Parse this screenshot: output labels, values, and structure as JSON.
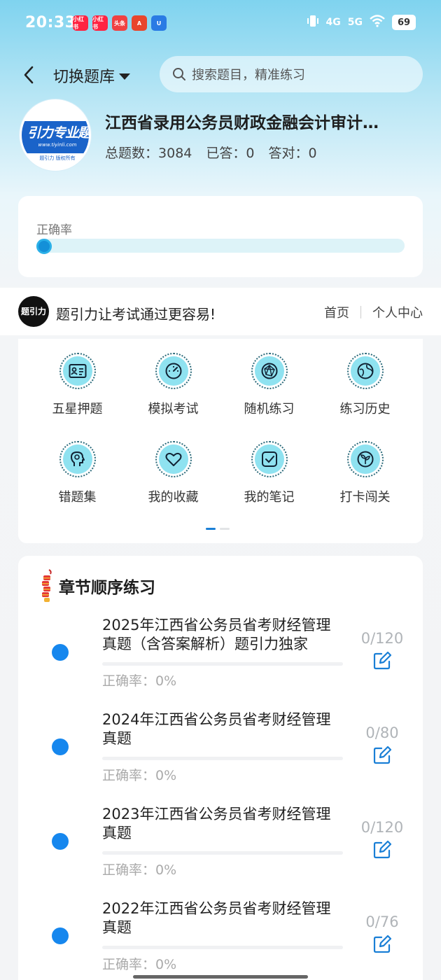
{
  "status_bar": {
    "time": "20:33",
    "battery": "69",
    "network_labels": [
      "4G",
      "5G"
    ],
    "apps": [
      {
        "label": "小红书",
        "color": "#ff2442"
      },
      {
        "label": "小红书",
        "color": "#ff2442"
      },
      {
        "label": "头条",
        "color": "#f04142"
      },
      {
        "label": "A",
        "color": "#e8452c"
      },
      {
        "label": "U",
        "color": "#2a7be4"
      }
    ]
  },
  "topbar": {
    "switch_label": "切换题库",
    "search_placeholder": "搜索题目，精准练习"
  },
  "bank": {
    "logo_title": "引力专业题",
    "logo_url": "www.tiyinli.com",
    "logo_copyright": "题引力 版权所有",
    "name": "江西省录用公务员财政金融会计审计…",
    "total_label": "总题数：",
    "total_value": "3084",
    "answered_label": "已答：",
    "answered_value": "0",
    "correct_label": "答对：",
    "correct_value": "0"
  },
  "accuracy": {
    "label": "正确率",
    "value_percent": 0
  },
  "brand": {
    "logo_text": "题引力",
    "slogan": "题引力让考试通过更容易!",
    "nav_home": "首页",
    "nav_profile": "个人中心"
  },
  "features": [
    {
      "label": "五星押题",
      "icon": "id-card-icon"
    },
    {
      "label": "模拟考试",
      "icon": "gauge-icon"
    },
    {
      "label": "随机练习",
      "icon": "network-icon"
    },
    {
      "label": "练习历史",
      "icon": "globe-icon"
    },
    {
      "label": "错题集",
      "icon": "head-icon"
    },
    {
      "label": "我的收藏",
      "icon": "heart-icon"
    },
    {
      "label": "我的笔记",
      "icon": "note-icon"
    },
    {
      "label": "打卡闯关",
      "icon": "leaf-icon"
    }
  ],
  "features_pager": {
    "pages": 2,
    "active": 0
  },
  "chapters": {
    "title": "章节顺序练习",
    "items": [
      {
        "name": "2025年江西省公务员省考财经管理真题（含答案解析）题引力独家",
        "count": "0/120",
        "accuracy": "正确率：0%"
      },
      {
        "name": "2024年江西省公务员省考财经管理真题",
        "count": "0/80",
        "accuracy": "正确率：0%"
      },
      {
        "name": "2023年江西省公务员省考财经管理真题",
        "count": "0/120",
        "accuracy": "正确率：0%"
      },
      {
        "name": "2022年江西省公务员省考财经管理真题",
        "count": "0/76",
        "accuracy": "正确率：0%"
      }
    ]
  },
  "colors": {
    "accent": "#1687ee",
    "feature_icon_bg": "#8fe2f0",
    "edit_icon": "#1a7fd6"
  }
}
